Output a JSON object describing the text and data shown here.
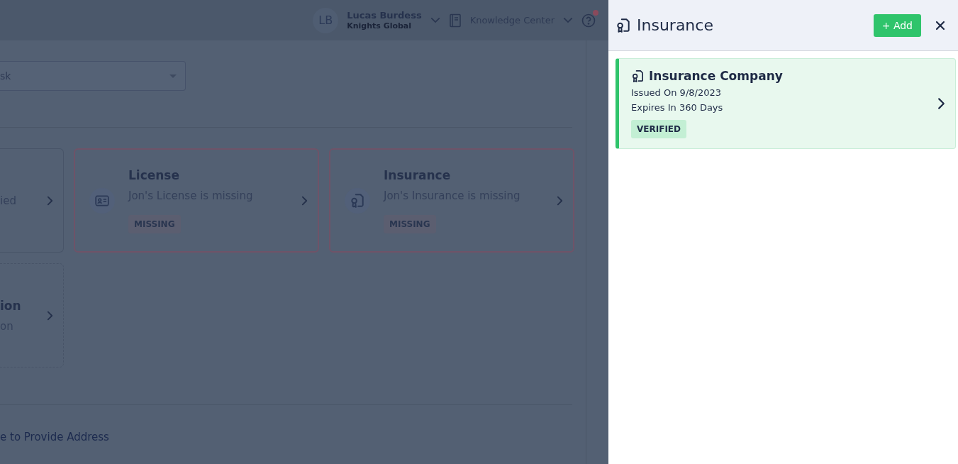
{
  "header": {
    "avatar_initials": "LB",
    "user_name": "Lucas Burdess",
    "company": "Knights Global",
    "help_link": "Knowledge Center",
    "notification_dot": true
  },
  "filter": {
    "value": "sk"
  },
  "cards": [
    {
      "kind": "plain",
      "description": "ied"
    },
    {
      "kind": "missing",
      "title": "License",
      "description": "Jon's License is missing",
      "badge": "MISSING"
    },
    {
      "kind": "missing",
      "title": "Insurance",
      "description": "Jon's Insurance is missing",
      "badge": "MISSING"
    },
    {
      "kind": "dashed",
      "title": "ion",
      "description": "on"
    }
  ],
  "footer_link": "e to Provide Address",
  "panel": {
    "title": "Insurance",
    "add_button": "+ Add",
    "records": [
      {
        "title": "Insurance Company",
        "issued": "Issued On 9/8/2023",
        "expires": "Expires In 360 Days",
        "badge": "VERIFIED"
      }
    ]
  }
}
